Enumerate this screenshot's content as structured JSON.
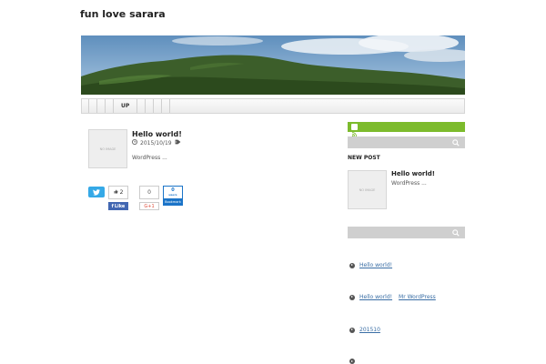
{
  "site": {
    "title": "fun love sarara"
  },
  "nav": {
    "items": [
      "",
      "",
      "",
      "",
      "UP",
      "",
      "",
      "",
      ""
    ]
  },
  "post": {
    "title": "Hello world!",
    "date": "2015/10/19",
    "excerpt": "WordPress  ...",
    "thumb_text": "NO IMAGE"
  },
  "social": {
    "fb_count": "2",
    "fb_like": "Like",
    "gplus_count": "0",
    "gplus_label": "G+1",
    "hatena_count": "0",
    "hatena_users": "users",
    "hatena_label": "Bookmark"
  },
  "sidebar": {
    "new_post_heading": "NEW POST",
    "new_post_title": "Hello world!",
    "new_post_excerpt": "WordPress  ...",
    "thumb_text": "NO IMAGE",
    "recent_comment_post": "Hello world!",
    "recent_comment_author": "Mr WordPress",
    "archive": "201510"
  },
  "colors": {
    "accent_green": "#7cbb2c",
    "twitter_blue": "#35a9e7",
    "facebook_blue": "#4267b2",
    "hatena_blue": "#1b74c8",
    "link": "#3a6ea5"
  }
}
